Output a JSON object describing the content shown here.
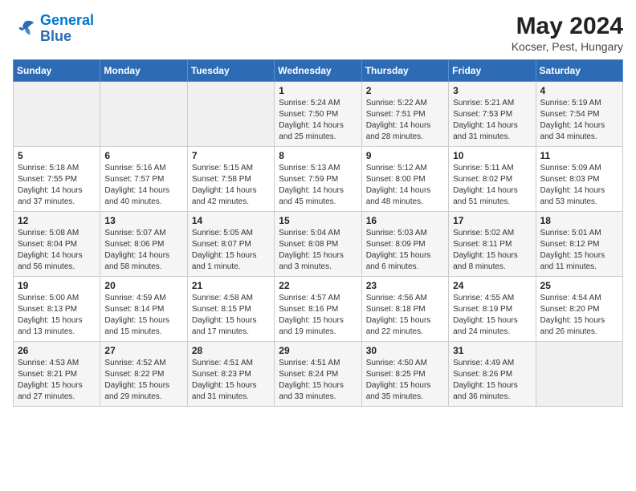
{
  "header": {
    "logo_line1": "General",
    "logo_line2": "Blue",
    "title": "May 2024",
    "subtitle": "Kocser, Pest, Hungary"
  },
  "days_of_week": [
    "Sunday",
    "Monday",
    "Tuesday",
    "Wednesday",
    "Thursday",
    "Friday",
    "Saturday"
  ],
  "weeks": [
    [
      {
        "day": "",
        "info": ""
      },
      {
        "day": "",
        "info": ""
      },
      {
        "day": "",
        "info": ""
      },
      {
        "day": "1",
        "info": "Sunrise: 5:24 AM\nSunset: 7:50 PM\nDaylight: 14 hours\nand 25 minutes."
      },
      {
        "day": "2",
        "info": "Sunrise: 5:22 AM\nSunset: 7:51 PM\nDaylight: 14 hours\nand 28 minutes."
      },
      {
        "day": "3",
        "info": "Sunrise: 5:21 AM\nSunset: 7:53 PM\nDaylight: 14 hours\nand 31 minutes."
      },
      {
        "day": "4",
        "info": "Sunrise: 5:19 AM\nSunset: 7:54 PM\nDaylight: 14 hours\nand 34 minutes."
      }
    ],
    [
      {
        "day": "5",
        "info": "Sunrise: 5:18 AM\nSunset: 7:55 PM\nDaylight: 14 hours\nand 37 minutes."
      },
      {
        "day": "6",
        "info": "Sunrise: 5:16 AM\nSunset: 7:57 PM\nDaylight: 14 hours\nand 40 minutes."
      },
      {
        "day": "7",
        "info": "Sunrise: 5:15 AM\nSunset: 7:58 PM\nDaylight: 14 hours\nand 42 minutes."
      },
      {
        "day": "8",
        "info": "Sunrise: 5:13 AM\nSunset: 7:59 PM\nDaylight: 14 hours\nand 45 minutes."
      },
      {
        "day": "9",
        "info": "Sunrise: 5:12 AM\nSunset: 8:00 PM\nDaylight: 14 hours\nand 48 minutes."
      },
      {
        "day": "10",
        "info": "Sunrise: 5:11 AM\nSunset: 8:02 PM\nDaylight: 14 hours\nand 51 minutes."
      },
      {
        "day": "11",
        "info": "Sunrise: 5:09 AM\nSunset: 8:03 PM\nDaylight: 14 hours\nand 53 minutes."
      }
    ],
    [
      {
        "day": "12",
        "info": "Sunrise: 5:08 AM\nSunset: 8:04 PM\nDaylight: 14 hours\nand 56 minutes."
      },
      {
        "day": "13",
        "info": "Sunrise: 5:07 AM\nSunset: 8:06 PM\nDaylight: 14 hours\nand 58 minutes."
      },
      {
        "day": "14",
        "info": "Sunrise: 5:05 AM\nSunset: 8:07 PM\nDaylight: 15 hours\nand 1 minute."
      },
      {
        "day": "15",
        "info": "Sunrise: 5:04 AM\nSunset: 8:08 PM\nDaylight: 15 hours\nand 3 minutes."
      },
      {
        "day": "16",
        "info": "Sunrise: 5:03 AM\nSunset: 8:09 PM\nDaylight: 15 hours\nand 6 minutes."
      },
      {
        "day": "17",
        "info": "Sunrise: 5:02 AM\nSunset: 8:11 PM\nDaylight: 15 hours\nand 8 minutes."
      },
      {
        "day": "18",
        "info": "Sunrise: 5:01 AM\nSunset: 8:12 PM\nDaylight: 15 hours\nand 11 minutes."
      }
    ],
    [
      {
        "day": "19",
        "info": "Sunrise: 5:00 AM\nSunset: 8:13 PM\nDaylight: 15 hours\nand 13 minutes."
      },
      {
        "day": "20",
        "info": "Sunrise: 4:59 AM\nSunset: 8:14 PM\nDaylight: 15 hours\nand 15 minutes."
      },
      {
        "day": "21",
        "info": "Sunrise: 4:58 AM\nSunset: 8:15 PM\nDaylight: 15 hours\nand 17 minutes."
      },
      {
        "day": "22",
        "info": "Sunrise: 4:57 AM\nSunset: 8:16 PM\nDaylight: 15 hours\nand 19 minutes."
      },
      {
        "day": "23",
        "info": "Sunrise: 4:56 AM\nSunset: 8:18 PM\nDaylight: 15 hours\nand 22 minutes."
      },
      {
        "day": "24",
        "info": "Sunrise: 4:55 AM\nSunset: 8:19 PM\nDaylight: 15 hours\nand 24 minutes."
      },
      {
        "day": "25",
        "info": "Sunrise: 4:54 AM\nSunset: 8:20 PM\nDaylight: 15 hours\nand 26 minutes."
      }
    ],
    [
      {
        "day": "26",
        "info": "Sunrise: 4:53 AM\nSunset: 8:21 PM\nDaylight: 15 hours\nand 27 minutes."
      },
      {
        "day": "27",
        "info": "Sunrise: 4:52 AM\nSunset: 8:22 PM\nDaylight: 15 hours\nand 29 minutes."
      },
      {
        "day": "28",
        "info": "Sunrise: 4:51 AM\nSunset: 8:23 PM\nDaylight: 15 hours\nand 31 minutes."
      },
      {
        "day": "29",
        "info": "Sunrise: 4:51 AM\nSunset: 8:24 PM\nDaylight: 15 hours\nand 33 minutes."
      },
      {
        "day": "30",
        "info": "Sunrise: 4:50 AM\nSunset: 8:25 PM\nDaylight: 15 hours\nand 35 minutes."
      },
      {
        "day": "31",
        "info": "Sunrise: 4:49 AM\nSunset: 8:26 PM\nDaylight: 15 hours\nand 36 minutes."
      },
      {
        "day": "",
        "info": ""
      }
    ]
  ]
}
